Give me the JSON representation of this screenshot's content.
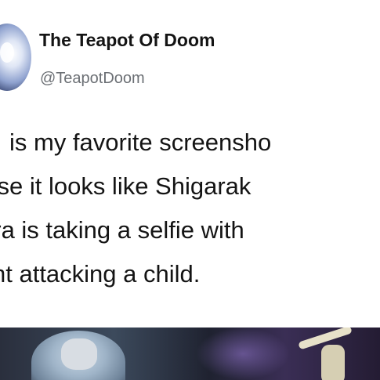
{
  "tweet": {
    "author": {
      "display_name": "The Teapot Of Doom",
      "handle": "@TeapotDoom",
      "avatar_icon": "profile-avatar-icon"
    },
    "text_lines": [
      "is my favorite screensho",
      "ause it looks like Shigarak",
      "ura is taking a selfie with",
      "nt attacking a child."
    ],
    "media": {
      "icon": "anime-screenshot-image"
    }
  },
  "colors": {
    "text": "#141414",
    "handle": "#6b6f74",
    "background": "#ffffff"
  }
}
